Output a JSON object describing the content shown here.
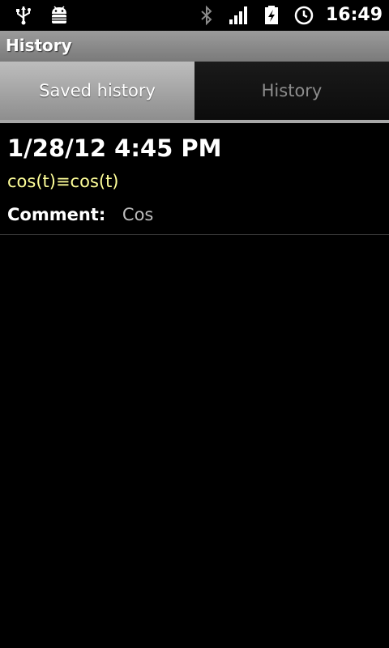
{
  "status_bar": {
    "time": "16:49",
    "left_icons": [
      "usb-icon",
      "android-debug-icon"
    ],
    "right_icons": [
      "bluetooth-icon",
      "signal-icon",
      "battery-charging-icon",
      "alarm-clock-icon"
    ]
  },
  "title_bar": {
    "title": "History"
  },
  "tabs": [
    {
      "label": "Saved history",
      "active": true
    },
    {
      "label": "History",
      "active": false
    }
  ],
  "entries": [
    {
      "date": "1/28/12 4:45 PM",
      "expression": "cos(t)≡cos(t)",
      "comment_label": "Comment:",
      "comment_value": "Cos"
    }
  ],
  "colors": {
    "background": "#000000",
    "expression": "#ffff99",
    "tab_active": "#a8a8a8"
  }
}
